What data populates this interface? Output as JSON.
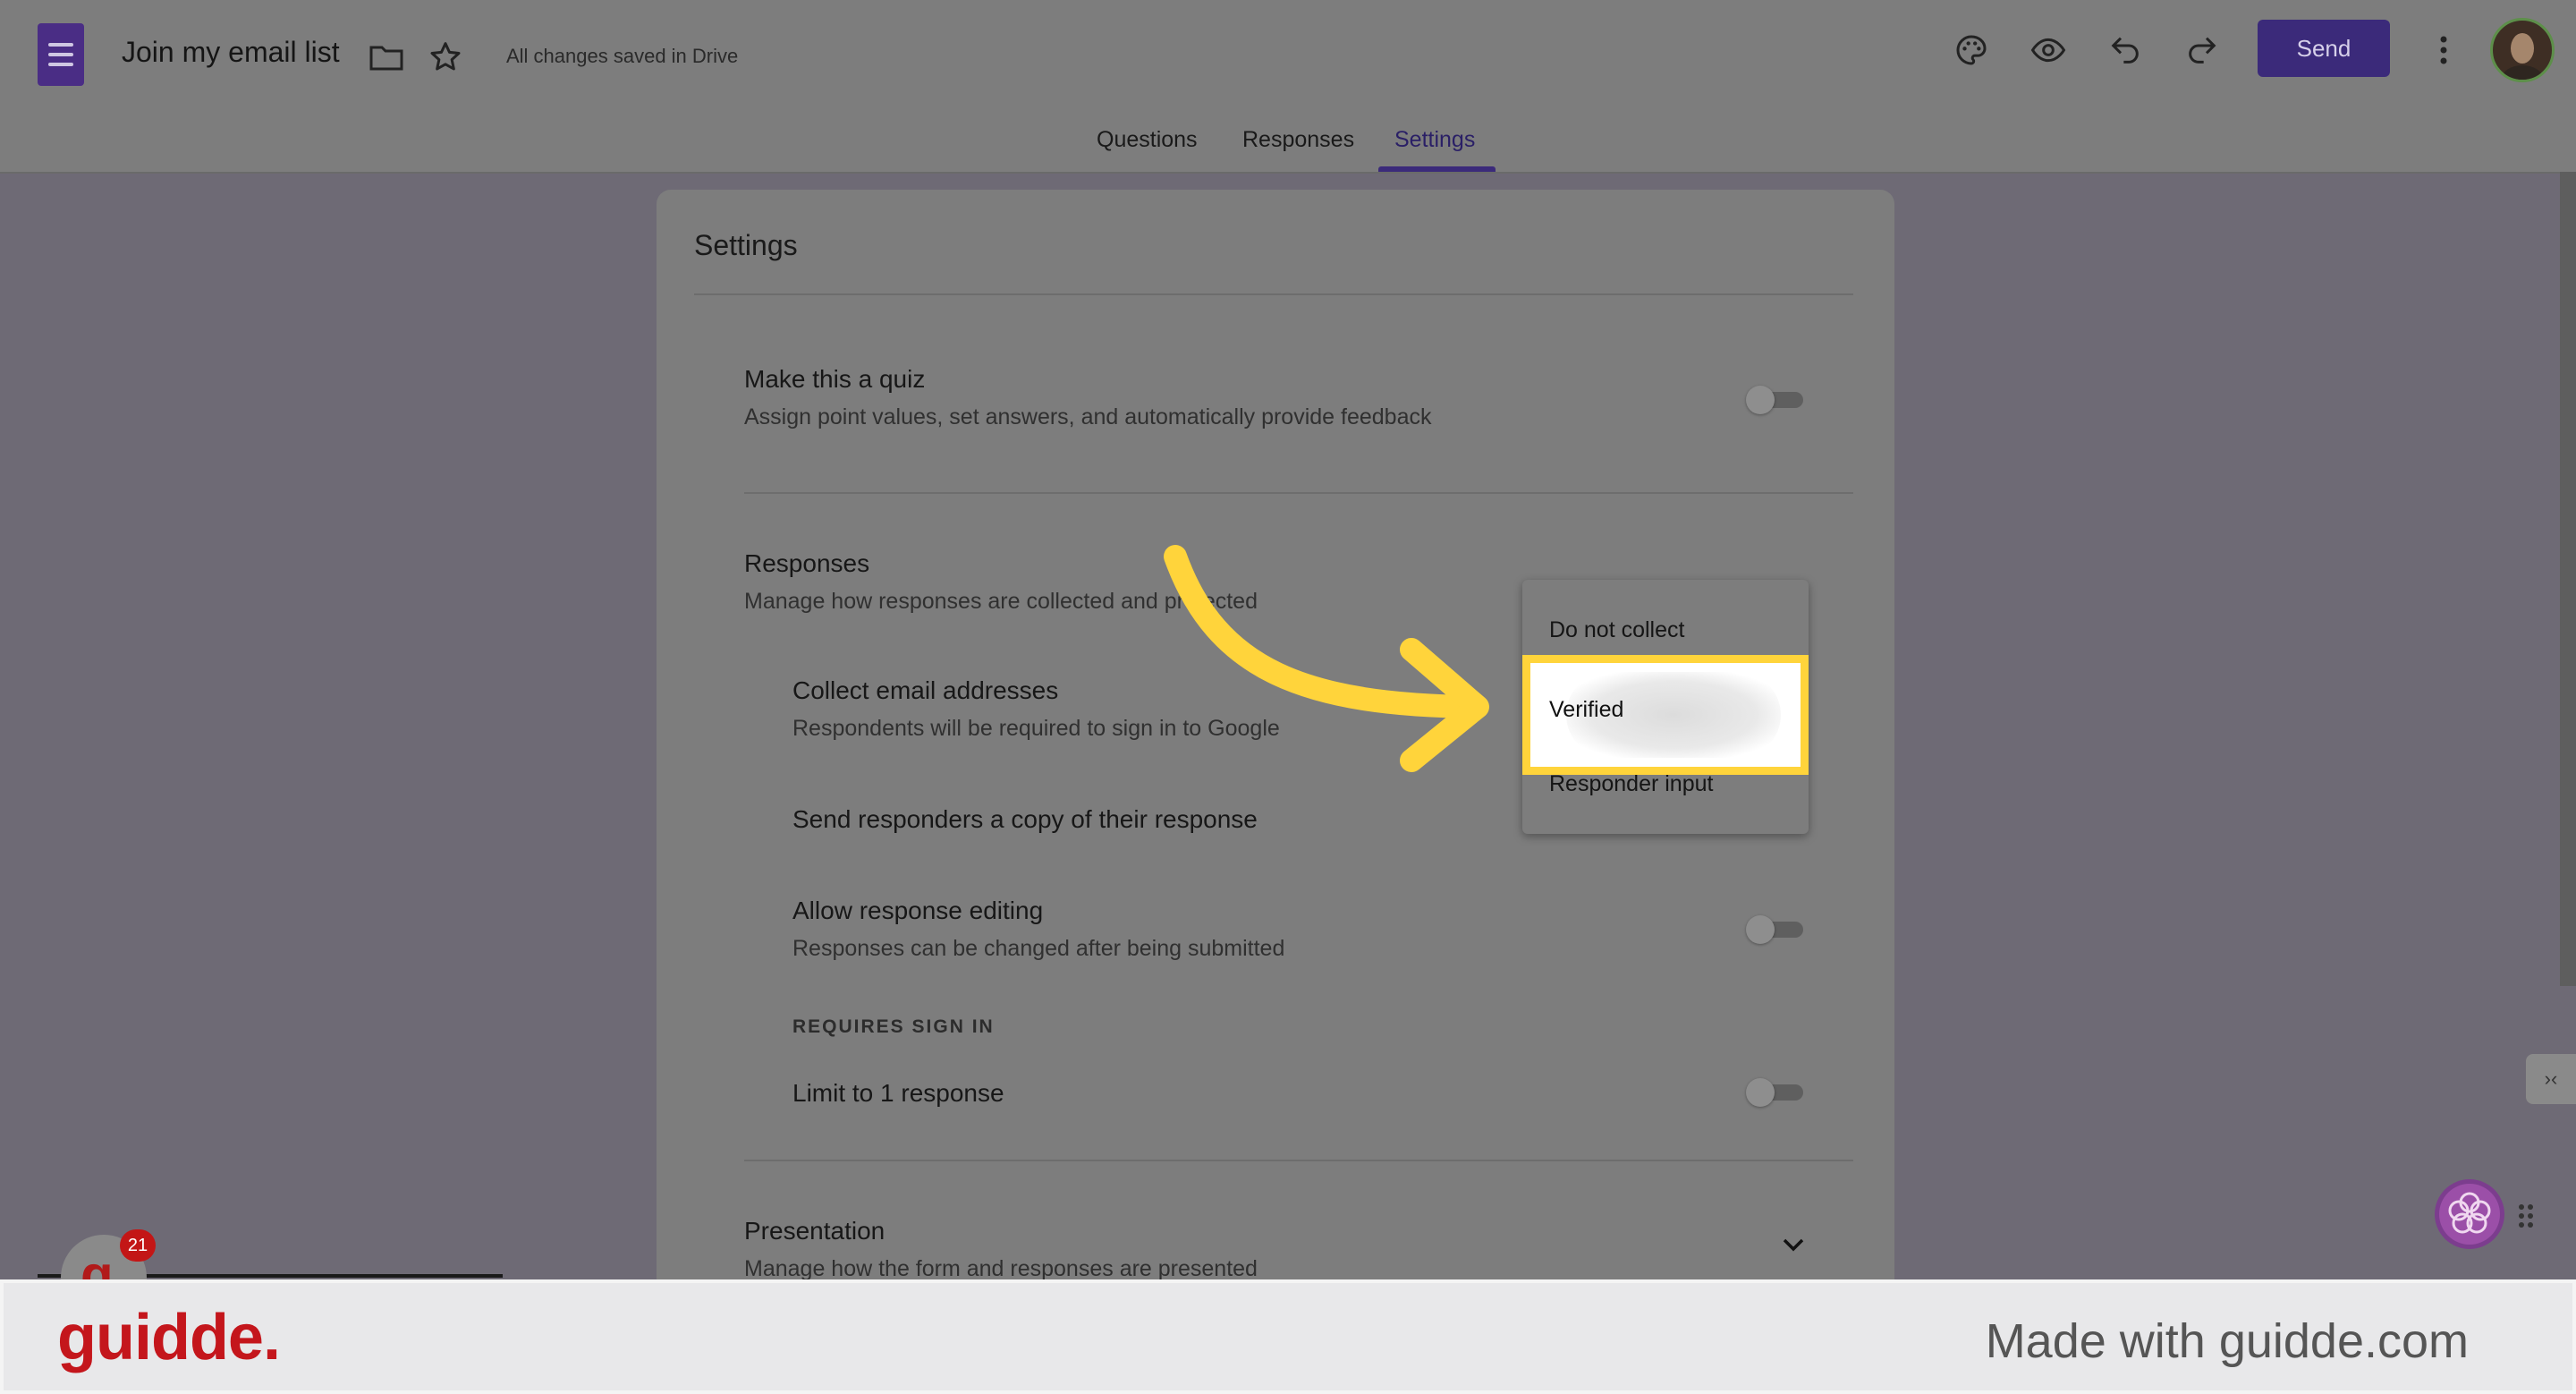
{
  "header": {
    "doc_title": "Join my email list",
    "saved_status": "All changes saved in Drive",
    "send_label": "Send"
  },
  "tabs": [
    {
      "label": "Questions",
      "active": false
    },
    {
      "label": "Responses",
      "active": false
    },
    {
      "label": "Settings",
      "active": true
    }
  ],
  "settings": {
    "title": "Settings",
    "quiz": {
      "title": "Make this a quiz",
      "desc": "Assign point values, set answers, and automatically provide feedback",
      "enabled": false
    },
    "responses": {
      "title": "Responses",
      "desc": "Manage how responses are collected and protected",
      "collect_email": {
        "title": "Collect email addresses",
        "desc": "Respondents will be required to sign in to Google"
      },
      "send_copy": {
        "title": "Send responders a copy of their response"
      },
      "allow_editing": {
        "title": "Allow response editing",
        "desc": "Responses can be changed after being submitted",
        "enabled": false
      },
      "requires_sign_in_label": "REQUIRES SIGN IN",
      "limit_one": {
        "title": "Limit to 1 response",
        "enabled": false
      }
    },
    "presentation": {
      "title": "Presentation",
      "desc": "Manage how the form and responses are presented"
    }
  },
  "dropdown": {
    "options": [
      "Do not collect",
      "Verified",
      "Responder input"
    ],
    "highlighted": "Verified"
  },
  "badge": {
    "count": "21"
  },
  "footer": {
    "logo": "guidde.",
    "credit": "Made with guidde.com"
  },
  "colors": {
    "accent": "#3b2a7a",
    "highlight": "#ffd43b",
    "arrow": "#ffd43b",
    "brand": "#c4161c"
  },
  "icons": [
    "forms-logo-icon",
    "folder-icon",
    "star-icon",
    "palette-icon",
    "preview-eye-icon",
    "undo-icon",
    "redo-icon",
    "more-vert-icon",
    "chevron-down-icon",
    "pointer-arrow-icon"
  ]
}
